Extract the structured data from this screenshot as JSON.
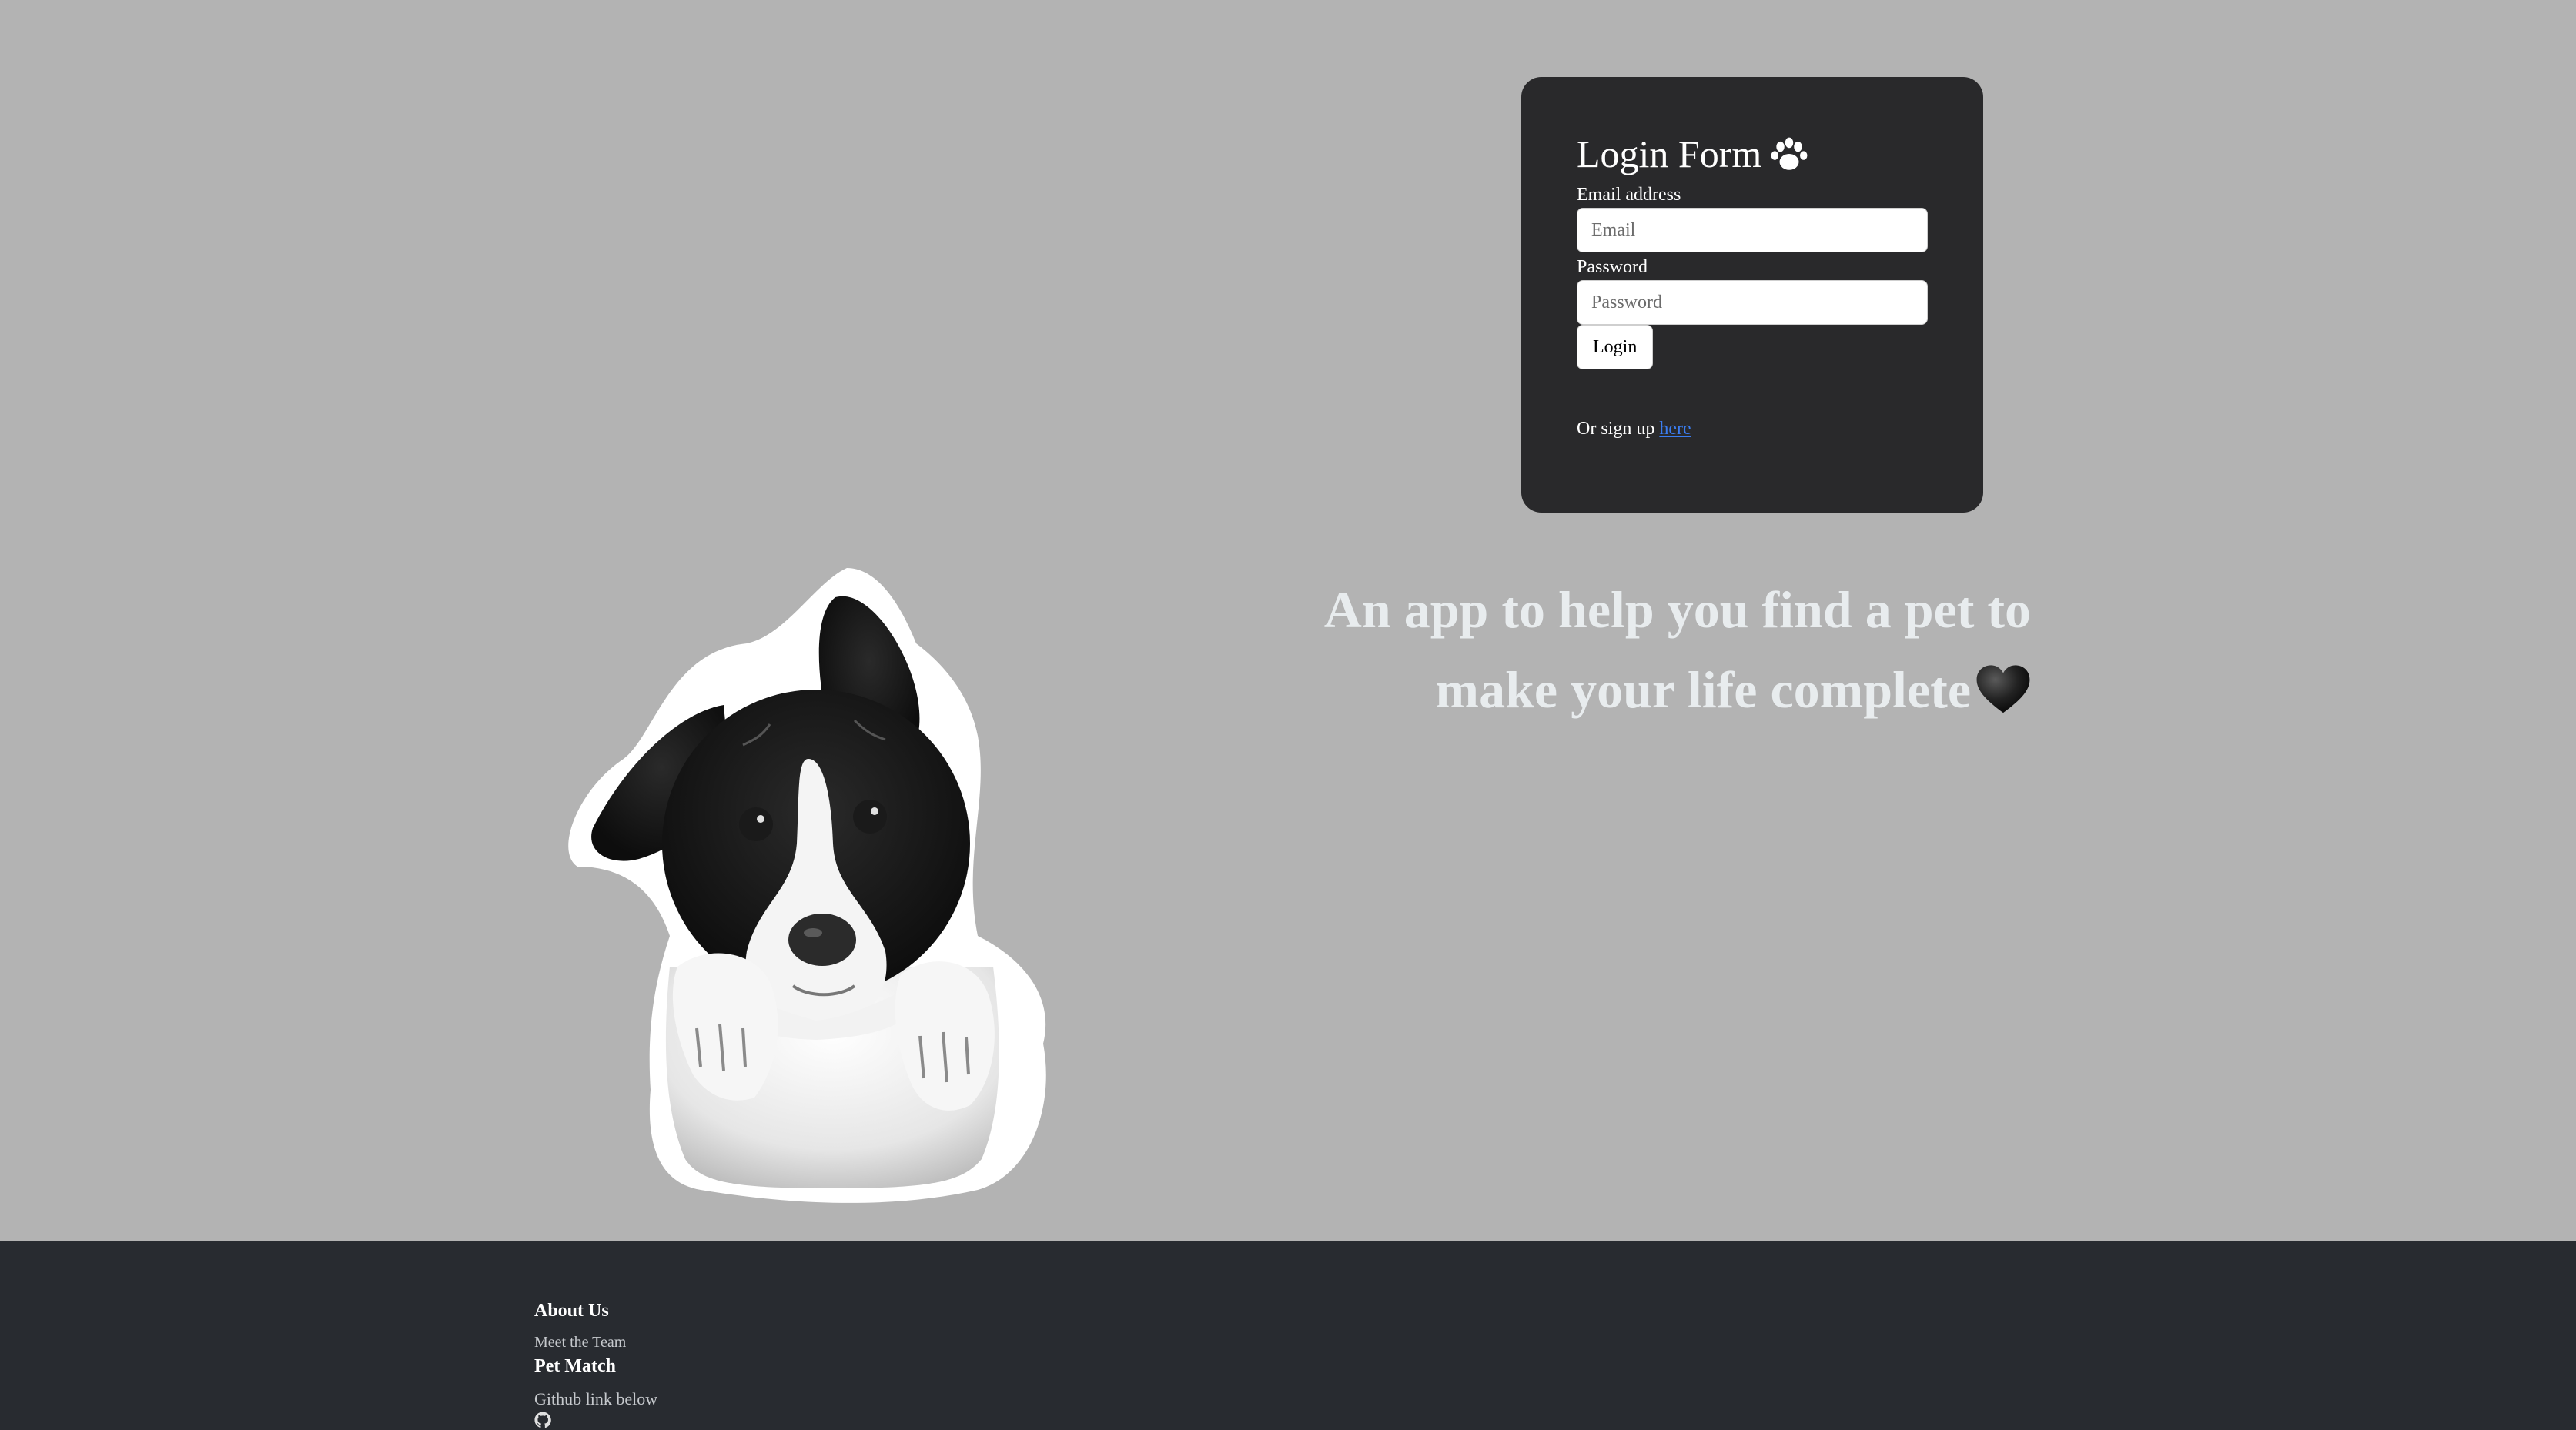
{
  "login_form": {
    "title": "Login Form",
    "title_icon": "paw-icon",
    "email_label": "Email address",
    "email_placeholder": "Email",
    "email_value": "",
    "password_label": "Password",
    "password_placeholder": "Password",
    "password_value": "",
    "login_button_label": "Login",
    "signup_prefix": "Or sign up",
    "signup_link_text": "here"
  },
  "hero": {
    "tagline_line1": "An app to help you find a pet to",
    "tagline_line2": "make your life complete",
    "tagline_icon": "black-heart-icon",
    "image": "dog-illustration"
  },
  "footer": {
    "about_heading": "About Us",
    "about_link": "Meet the Team",
    "app_heading": "Pet Match",
    "github_text": "Github link below",
    "github_icon": "github-icon"
  },
  "colors": {
    "page_background": "#b3b3b3",
    "card_background": "#29292b",
    "footer_background": "#282b30",
    "link": "#3b7df0",
    "tagline": "#e8ecee"
  }
}
